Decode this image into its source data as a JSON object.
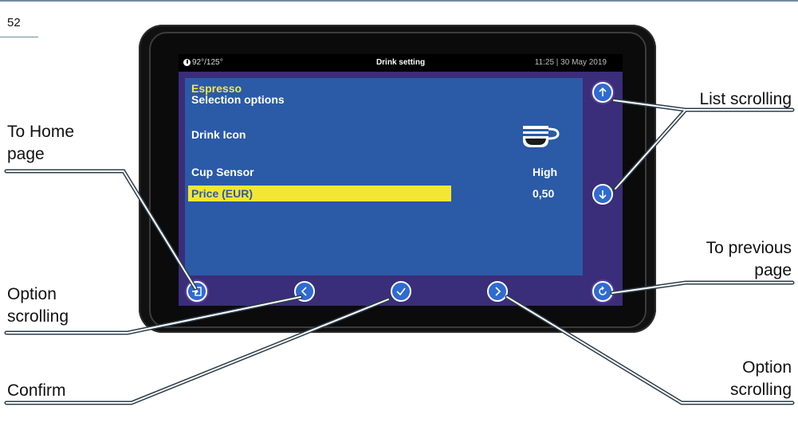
{
  "page": {
    "number": "52"
  },
  "device": {
    "status_bar": {
      "temperature": "92°/125°",
      "title": "Drink setting",
      "datetime": "11:25 | 30 May 2019"
    },
    "drink_name": "Espresso",
    "heading": "Selection options",
    "rows": [
      {
        "label": "Drink Icon",
        "value": ""
      },
      {
        "label": "Cup Sensor",
        "value": "High"
      },
      {
        "label": "Price (EUR)",
        "value": "0,50",
        "selected": true
      }
    ],
    "icons": {
      "temperature": "thermometer-icon",
      "drink": "coffee-cup-icon",
      "scroll_up": "arrow-up-icon",
      "scroll_down": "arrow-down-icon",
      "home": "exit-door-icon",
      "prev_option": "chevron-left-icon",
      "confirm": "checkmark-icon",
      "next_option": "chevron-right-icon",
      "back": "refresh-arrow-icon"
    },
    "colors": {
      "panel": "#2b5aa7",
      "frame": "#3a2d7a",
      "highlight": "#f4e634",
      "accent_text": "#f7e93c"
    }
  },
  "callouts": {
    "to_home": [
      "To Home",
      "page"
    ],
    "option_scrolling_left": [
      "Option",
      "scrolling"
    ],
    "confirm": [
      "Confirm"
    ],
    "list_scrolling": [
      "List scrolling"
    ],
    "to_previous": [
      "To previous",
      "page"
    ],
    "option_scrolling_right": [
      "Option",
      "scrolling"
    ]
  }
}
